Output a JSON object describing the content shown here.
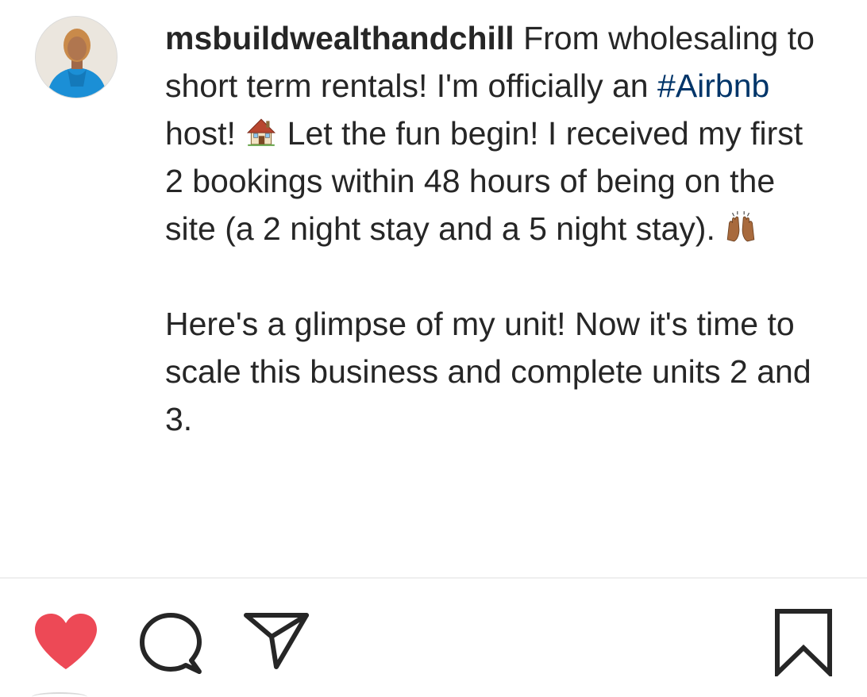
{
  "post": {
    "username": "msbuildwealthandchill",
    "caption_part1": " From wholesaling to short term rentals! I'm officially an ",
    "hashtag": "#Airbnb",
    "caption_part2": " host! ",
    "caption_part3": " Let the fun begin! I received my first 2 bookings within 48 hours of being on the site (a 2 night stay and a 5 night stay). ",
    "caption_paragraph2": "Here's a glimpse of my unit! Now it's time to scale this business and complete units 2 and 3.",
    "emojis": [
      "house-emoji",
      "raising-hands-emoji"
    ]
  },
  "actions": {
    "liked": true,
    "like_color": "#ed4956",
    "icons": [
      "heart-icon",
      "comment-icon",
      "share-icon",
      "bookmark-icon"
    ]
  },
  "colors": {
    "text": "#262626",
    "hashtag": "#003569",
    "divider": "#efefef"
  }
}
